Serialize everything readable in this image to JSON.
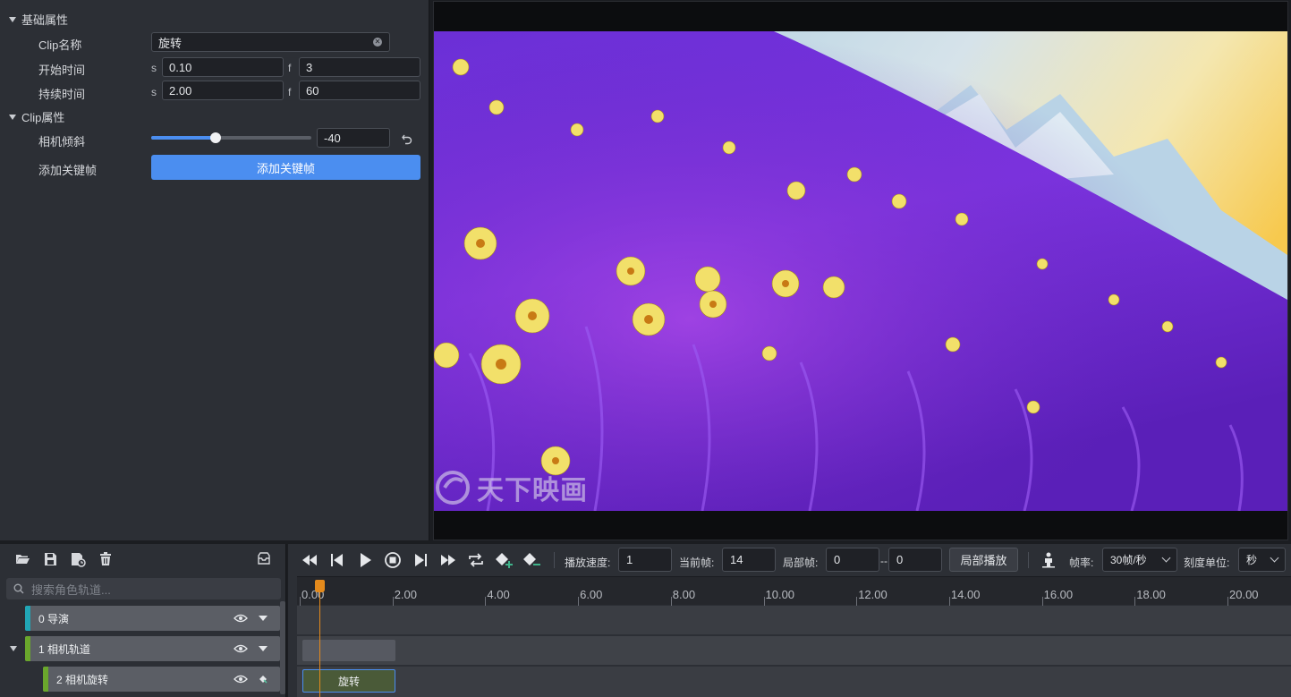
{
  "properties": {
    "basic_section": "基础属性",
    "clip_name_label": "Clip名称",
    "clip_name_value": "旋转",
    "start_time_label": "开始时间",
    "start_s_unit": "s",
    "start_s_value": "0.10",
    "start_f_unit": "f",
    "start_f_value": "3",
    "duration_label": "持续时间",
    "duration_s_unit": "s",
    "duration_s_value": "2.00",
    "duration_f_unit": "f",
    "duration_f_value": "60",
    "clip_section": "Clip属性",
    "camera_tilt_label": "相机倾斜",
    "camera_tilt_value": "-40",
    "camera_tilt_slider_fraction": 0.4,
    "add_keyframe_label": "添加关键帧",
    "add_keyframe_button": "添加关键帧"
  },
  "viewport": {
    "watermark_text": "天下映画"
  },
  "tracks": {
    "toolbar_icons": [
      "folder-open-icon",
      "save-icon",
      "save-as-icon",
      "trash-icon",
      "inbox-icon"
    ],
    "search_placeholder": "搜索角色轨道...",
    "items": [
      {
        "label": "0 导演",
        "color": "#21a6b6",
        "expandable": false
      },
      {
        "label": "1 相机轨道",
        "color": "#6aa72c",
        "expandable": true
      },
      {
        "label": "2 相机旋转",
        "color": "#6aa72c",
        "expandable": false
      }
    ]
  },
  "timeline": {
    "controls": [
      "rewind-icon",
      "step-back-icon",
      "play-icon",
      "stop-icon",
      "step-forward-icon",
      "fast-forward-icon",
      "loop-icon",
      "add-keyframe-icon",
      "remove-keyframe-icon"
    ],
    "speed_label": "播放速度:",
    "speed_value": "1",
    "current_frame_label": "当前帧:",
    "current_frame_value": "14",
    "local_frame_label": "局部帧:",
    "local_frame_start": "0",
    "local_frame_dash": "--",
    "local_frame_end": "0",
    "local_play_button": "局部播放",
    "frame_rate_label": "帧率:",
    "frame_rate_value": "30帧/秒",
    "scale_unit_label": "刻度单位:",
    "scale_unit_value": "秒",
    "ruler_ticks": [
      "0.00",
      "2.00",
      "4.00",
      "6.00",
      "8.00",
      "10.00",
      "12.00",
      "14.00",
      "16.00",
      "18.00",
      "20.00"
    ],
    "clip_label": "旋转",
    "accent_color": "#e48a1c"
  }
}
